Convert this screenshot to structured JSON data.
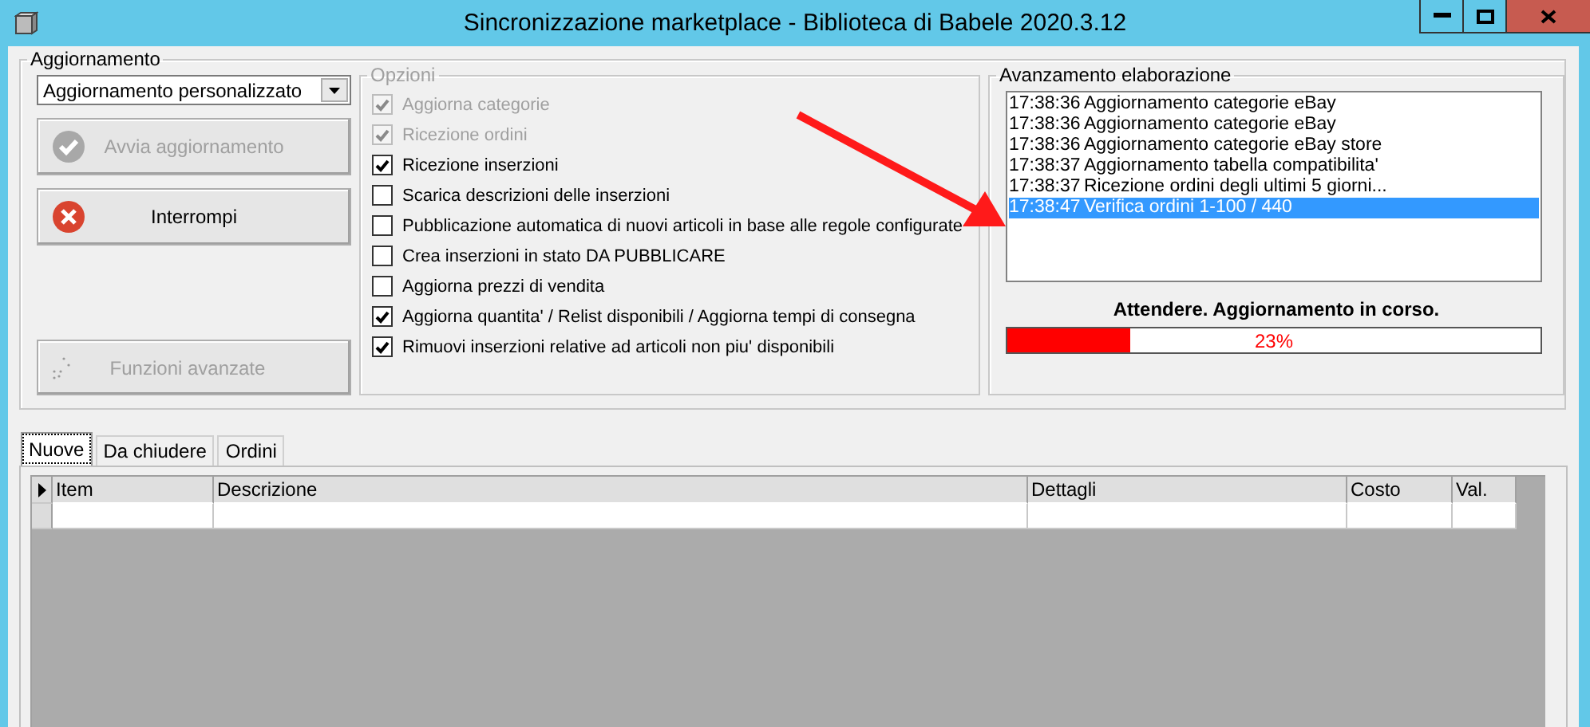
{
  "window": {
    "title": "Sincronizzazione marketplace - Biblioteca di Babele 2020.3.12"
  },
  "update_group": {
    "legend": "Aggiornamento",
    "mode_dropdown": {
      "value": "Aggiornamento personalizzato"
    },
    "buttons": [
      {
        "label": "Avvia aggiornamento",
        "kind": "check",
        "disabled": true
      },
      {
        "label": "Interrompi",
        "kind": "stop",
        "disabled": false
      }
    ],
    "advanced_button": {
      "label": "Funzioni avanzate",
      "disabled": true
    }
  },
  "options": {
    "legend": "Opzioni",
    "items": [
      {
        "label": "Aggiorna categorie",
        "checked": true,
        "disabled": true
      },
      {
        "label": "Ricezione ordini",
        "checked": true,
        "disabled": true
      },
      {
        "label": "Ricezione inserzioni",
        "checked": true,
        "disabled": false
      },
      {
        "label": "Scarica descrizioni delle inserzioni",
        "checked": false,
        "disabled": false
      },
      {
        "label": "Pubblicazione automatica di nuovi articoli in base alle regole configurate",
        "checked": false,
        "disabled": false
      },
      {
        "label": "Crea inserzioni in stato DA PUBBLICARE",
        "checked": false,
        "disabled": false
      },
      {
        "label": "Aggiorna prezzi di vendita",
        "checked": false,
        "disabled": false
      },
      {
        "label": "Aggiorna quantita' / Relist disponibili / Aggiorna tempi di consegna",
        "checked": true,
        "disabled": false
      },
      {
        "label": "Rimuovi inserzioni relative ad articoli non piu' disponibili",
        "checked": true,
        "disabled": false
      }
    ]
  },
  "progress": {
    "legend": "Avanzamento elaborazione",
    "log": [
      {
        "time": "17:38:36",
        "message": "Aggiornamento categorie eBay",
        "selected": false
      },
      {
        "time": "17:38:36",
        "message": "Aggiornamento categorie eBay",
        "selected": false
      },
      {
        "time": "17:38:36",
        "message": "Aggiornamento categorie eBay store",
        "selected": false
      },
      {
        "time": "17:38:37",
        "message": "Aggiornamento tabella compatibilita'",
        "selected": false
      },
      {
        "time": "17:38:37",
        "message": "Ricezione ordini degli ultimi 5 giorni...",
        "selected": false
      },
      {
        "time": "17:38:47",
        "message": "Verifica ordini 1-100 / 440",
        "selected": true
      }
    ],
    "status": "Attendere. Aggiornamento in corso.",
    "level": 0.23,
    "reading": "23%"
  },
  "tabs": [
    {
      "label": "Nuove",
      "selected": true
    },
    {
      "label": "Da chiudere",
      "selected": false
    },
    {
      "label": "Ordini",
      "selected": false
    }
  ],
  "table": {
    "columns": [
      "Item",
      "Descrizione",
      "Dettagli",
      "Costo",
      "Val."
    ]
  }
}
